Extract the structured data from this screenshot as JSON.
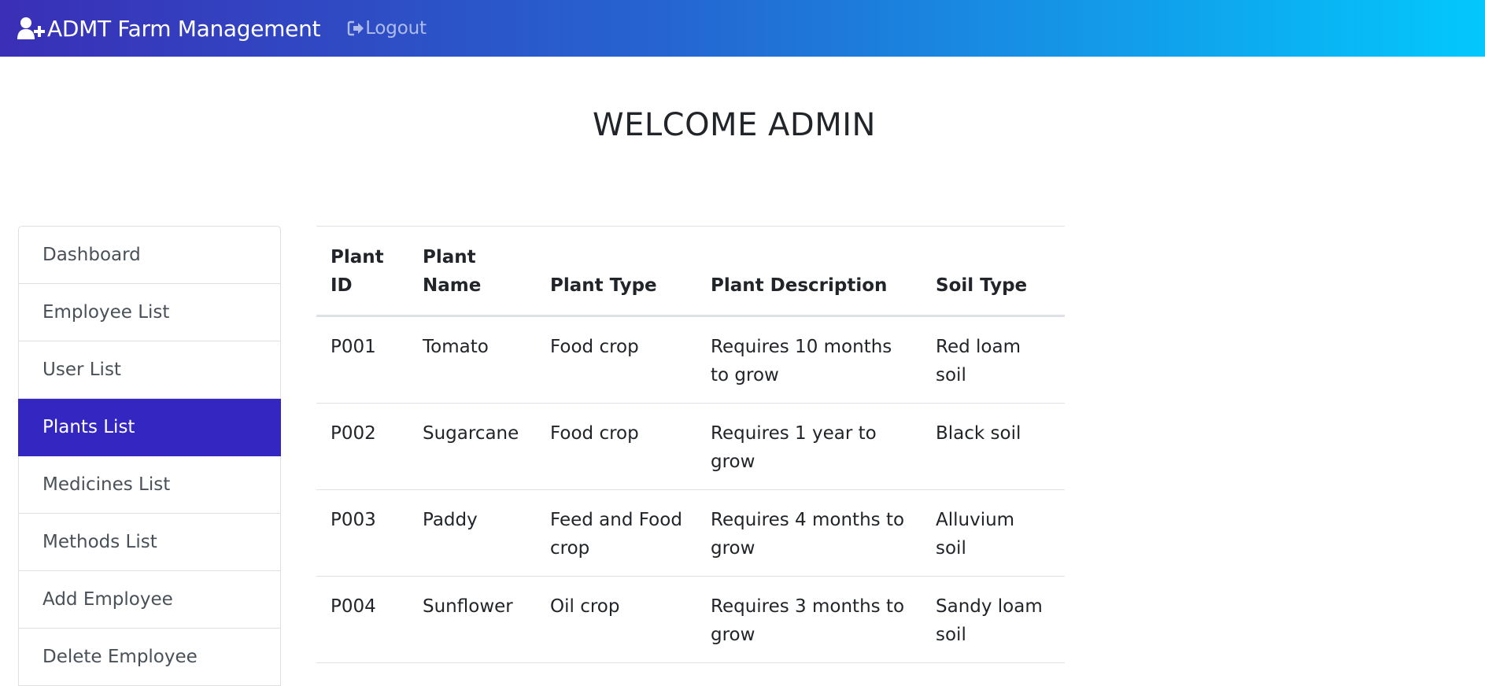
{
  "header": {
    "brand_label": "ADMT Farm Management",
    "brand_icon": "user-plus-icon",
    "logout_label": "Logout",
    "logout_icon": "sign-out-icon",
    "gradient_colors": [
      "#3a2fb6",
      "#2565d1",
      "#03c8fd"
    ]
  },
  "main": {
    "welcome": "WELCOME ADMIN"
  },
  "sidebar": {
    "active_color": "#3426c0",
    "items": [
      {
        "label": "Dashboard"
      },
      {
        "label": "Employee List"
      },
      {
        "label": "User List"
      },
      {
        "label": "Plants List",
        "active": true
      },
      {
        "label": "Medicines List"
      },
      {
        "label": "Methods List"
      },
      {
        "label": "Add Employee"
      },
      {
        "label": "Delete Employee"
      }
    ]
  },
  "table": {
    "columns": [
      "Plant ID",
      "Plant Name",
      "Plant Type",
      "Plant Description",
      "Soil Type"
    ],
    "rows": [
      [
        "P001",
        "Tomato",
        "Food crop",
        "Requires 10 months to grow",
        "Red loam soil"
      ],
      [
        "P002",
        "Sugarcane",
        "Food crop",
        "Requires 1 year to grow",
        "Black soil"
      ],
      [
        "P003",
        "Paddy",
        "Feed and Food crop",
        "Requires 4 months to grow",
        "Alluvium soil"
      ],
      [
        "P004",
        "Sunflower",
        "Oil crop",
        "Requires 3 months to grow",
        "Sandy loam soil"
      ]
    ]
  }
}
